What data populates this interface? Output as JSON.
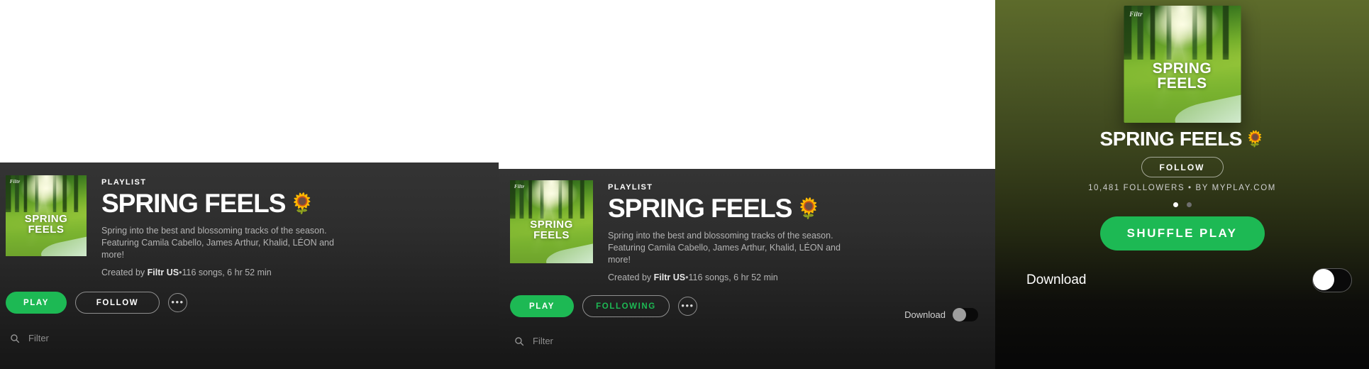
{
  "playlist": {
    "kicker": "PLAYLIST",
    "title": "SPRING FEELS",
    "flower": "🌻",
    "description": "Spring into the best and blossoming tracks of the season. Featuring Camila Cabello, James Arthur, Khalid, LÉON and more!",
    "created_prefix": "Created by",
    "creator": "Filtr US",
    "separator": "•",
    "stats": "116 songs, 6 hr 52 min",
    "artwork": {
      "brand": "Filtr",
      "line1": "SPRING",
      "line2": "FEELS"
    }
  },
  "desktop_unfollowed": {
    "play_label": "PLAY",
    "follow_label": "FOLLOW",
    "more_label": "•••",
    "filter_placeholder": "Filter",
    "search_icon": "search-icon"
  },
  "desktop_followed": {
    "play_label": "PLAY",
    "follow_label": "FOLLOWING",
    "more_label": "•••",
    "filter_placeholder": "Filter",
    "download_label": "Download",
    "download_on": false
  },
  "mobile": {
    "title": "SPRING FEELS",
    "flower": "🌻",
    "follow_label": "FOLLOW",
    "followers": "10,481 FOLLOWERS • BY MYPLAY.COM",
    "shuffle_label": "SHUFFLE PLAY",
    "download_label": "Download",
    "download_on": false,
    "carousel": {
      "total": 2,
      "active": 1
    }
  },
  "colors": {
    "accent_green": "#1db954",
    "panel_top": "#343434",
    "panel_bottom": "#161616",
    "mobile_top": "#5d6b2b",
    "muted_text": "#b3b3b3"
  }
}
